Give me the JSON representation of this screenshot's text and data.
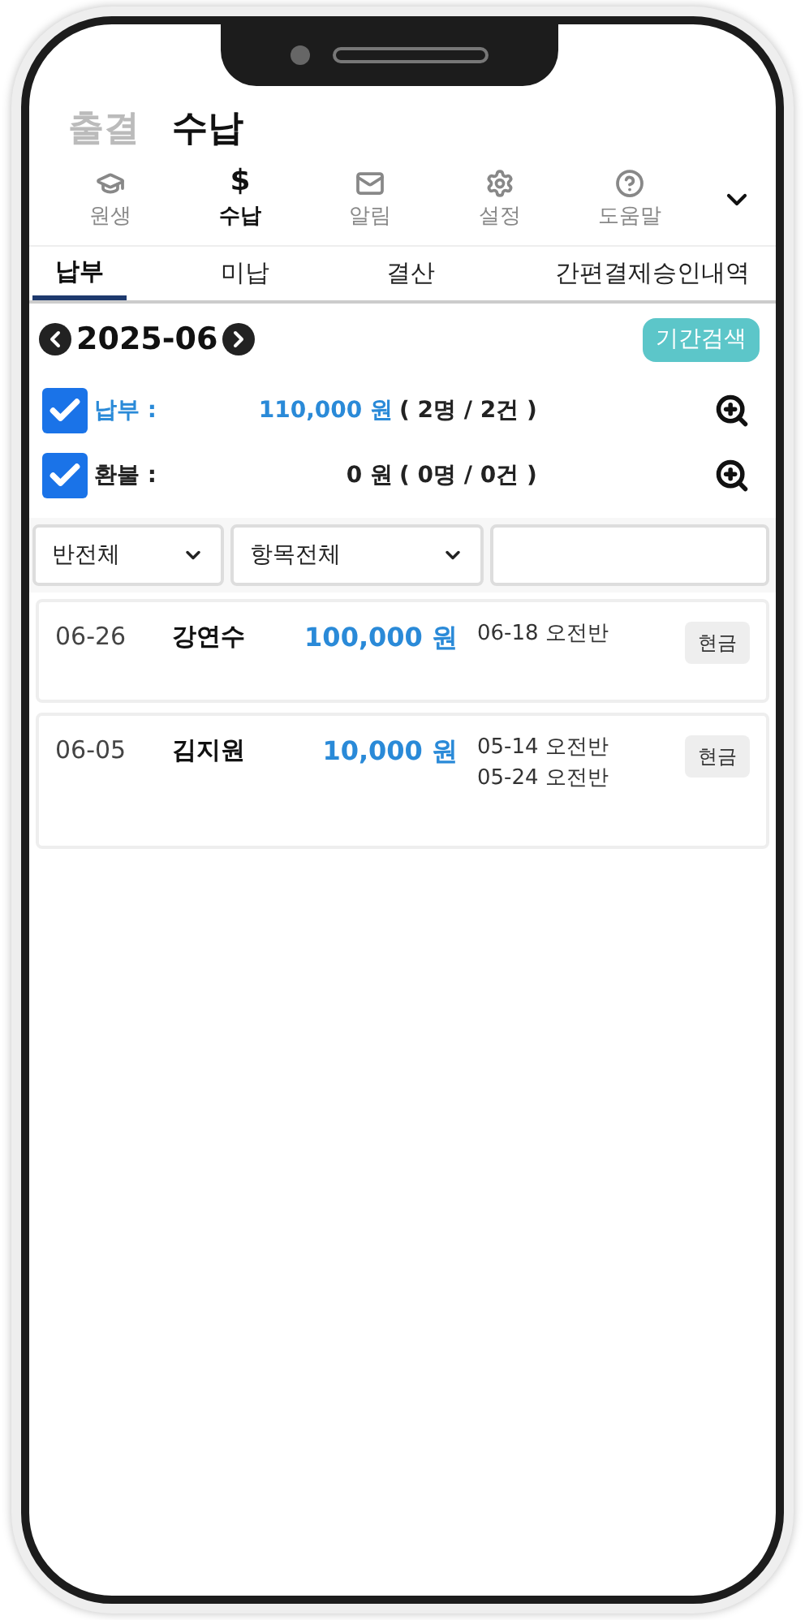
{
  "header_tabs": [
    {
      "label": "출결",
      "selected": false
    },
    {
      "label": "수납",
      "selected": true
    }
  ],
  "nav": [
    {
      "kind": "icon",
      "label": "원생",
      "selected": false
    },
    {
      "kind": "glyph",
      "glyph": "$",
      "label": "수납",
      "selected": true
    },
    {
      "kind": "icon",
      "label": "알림",
      "selected": false
    },
    {
      "kind": "icon",
      "label": "설정",
      "selected": false
    },
    {
      "kind": "icon",
      "label": "도움말",
      "selected": false
    }
  ],
  "sub_tabs": [
    {
      "label": "납부",
      "selected": true
    },
    {
      "label": "미납",
      "selected": false
    },
    {
      "label": "결산",
      "selected": false
    },
    {
      "label": "간편결제승인내역",
      "selected": false
    }
  ],
  "period": {
    "month": "2025-06",
    "search_button": "기간검색"
  },
  "summary": [
    {
      "kind": "payment",
      "label": "납부 :",
      "amount": "110,000 원",
      "counts": "( 2명 / 2건 )",
      "checked": true
    },
    {
      "kind": "refund",
      "label": "환불 :",
      "amount": "0 원",
      "counts": "( 0명 / 0건 )",
      "checked": true
    }
  ],
  "filters": {
    "class_select": "반전체",
    "item_select": "항목전체"
  },
  "payments": [
    {
      "date": "06-26",
      "name": "강연수",
      "amount": "100,000 원",
      "items": [
        "06-18 오전반"
      ],
      "method": "현금"
    },
    {
      "date": "06-05",
      "name": "김지원",
      "amount": "10,000 원",
      "items": [
        "05-14 오전반",
        "05-24 오전반"
      ],
      "method": "현금"
    }
  ]
}
